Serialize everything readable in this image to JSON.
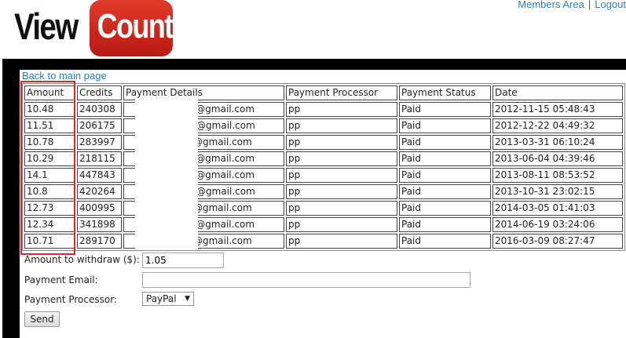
{
  "header": {
    "logo_view": "View",
    "logo_count": "Count",
    "members_area": "Members Area",
    "separator": "|",
    "logout": "Logout"
  },
  "back_link": "Back to main page",
  "table": {
    "columns": [
      "Amount",
      "Credits",
      "Payment Details",
      "Payment Processor",
      "Payment Status",
      "Date"
    ],
    "rows": [
      {
        "amount": "10.48",
        "credits": "240308",
        "details": "'@gmail.com",
        "processor": "pp",
        "status": "Paid",
        "date": "2012-11-15 05:48:43"
      },
      {
        "amount": "11.51",
        "credits": "206175",
        "details": "/@gmail.com",
        "processor": "pp",
        "status": "Paid",
        "date": "2012-12-22 04:49:32"
      },
      {
        "amount": "10.78",
        "credits": "283997",
        "details": "@gmail.com",
        "processor": "pp",
        "status": "Paid",
        "date": "2013-03-31 06:10:24"
      },
      {
        "amount": "10.29",
        "credits": "218115",
        "details": "'@gmail.com",
        "processor": "pp",
        "status": "Paid",
        "date": "2013-06-04 04:39:46"
      },
      {
        "amount": "14.1",
        "credits": "447843",
        "details": "'@gmail.com",
        "processor": "pp",
        "status": "Paid",
        "date": "2013-08-11 08:53:52"
      },
      {
        "amount": "10.8",
        "credits": "420264",
        "details": "/@gmail.com",
        "processor": "pp",
        "status": "Paid",
        "date": "2013-10-31 23:02:15"
      },
      {
        "amount": "12.73",
        "credits": "400995",
        "details": "@gmail.com",
        "processor": "pp",
        "status": "Paid",
        "date": "2014-03-05 01:41:03"
      },
      {
        "amount": "12.34",
        "credits": "341898",
        "details": "'@gmail.com",
        "processor": "pp",
        "status": "Paid",
        "date": "2014-06-19 03:24:06"
      },
      {
        "amount": "10.71",
        "credits": "289170",
        "details": "@gmail.com",
        "processor": "pp",
        "status": "Paid",
        "date": "2016-03-09 08:27:47"
      }
    ]
  },
  "form": {
    "amount_label": "Amount to withdraw ($):",
    "amount_value": "1.05",
    "email_label": "Payment Email:",
    "email_value": "",
    "processor_label": "Payment Processor:",
    "processor_selected": "PayPal",
    "send_label": "Send"
  },
  "colors": {
    "link": "#2a7fc0",
    "band": "#000000",
    "highlight": "#d9282a",
    "logo_red": "#d3261c"
  },
  "icons": {
    "dropdown": "chevron-down-icon"
  }
}
